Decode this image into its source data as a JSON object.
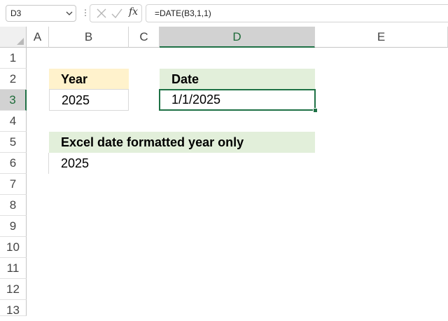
{
  "formula_bar": {
    "name_box": "D3",
    "formula": "=DATE(B3,1,1)",
    "fx_label": "fx",
    "more_icon": "vertical-ellipsis"
  },
  "columns": [
    "A",
    "B",
    "C",
    "D",
    "E"
  ],
  "rows": [
    "1",
    "2",
    "3",
    "4",
    "5",
    "6",
    "7",
    "8",
    "9",
    "10",
    "11",
    "12",
    "13"
  ],
  "selected_cell": "D3",
  "cells": {
    "B2": "Year",
    "B3": "2025",
    "D2": "Date",
    "D3": "1/1/2025",
    "B5": "Excel date formatted year only",
    "B6": "2025"
  },
  "colors": {
    "year_header_fill": "#fff2cc",
    "green_header_fill": "#e2efda",
    "selection_accent": "#1e7145"
  }
}
